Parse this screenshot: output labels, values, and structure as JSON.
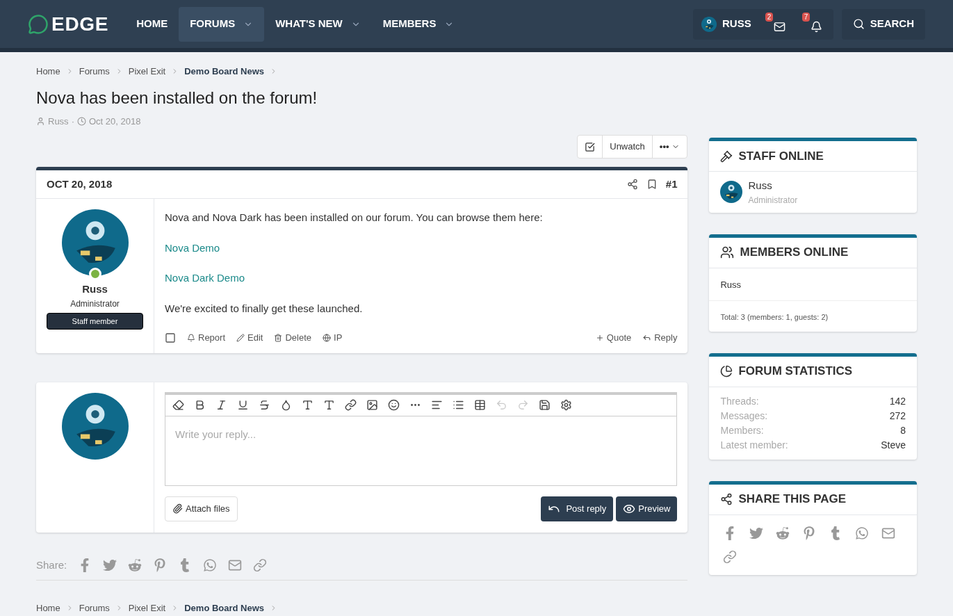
{
  "header": {
    "logo": "EDGE",
    "nav": [
      {
        "label": "HOME",
        "selected": false,
        "dropdown": false
      },
      {
        "label": "FORUMS",
        "selected": true,
        "dropdown": true
      },
      {
        "label": "WHAT'S NEW",
        "selected": false,
        "dropdown": true
      },
      {
        "label": "MEMBERS",
        "selected": false,
        "dropdown": true
      }
    ],
    "user": "RUSS",
    "inbox_count": "2",
    "alerts_count": "7",
    "search": "SEARCH"
  },
  "breadcrumbs": [
    {
      "label": "Home",
      "current": false
    },
    {
      "label": "Forums",
      "current": false
    },
    {
      "label": "Pixel Exit",
      "current": false
    },
    {
      "label": "Demo Board News",
      "current": true
    }
  ],
  "breadcrumbs_bottom": [
    {
      "label": "Home",
      "current": false
    },
    {
      "label": "Forums",
      "current": false
    },
    {
      "label": "Pixel Exit",
      "current": false
    },
    {
      "label": "Demo Board News",
      "current": true
    }
  ],
  "thread": {
    "title": "Nova has been installed on the forum!",
    "author": "Russ",
    "separator": "·",
    "date": "Oct 20, 2018",
    "unwatch": "Unwatch",
    "more": "•••"
  },
  "post": {
    "date": "OCT 20, 2018",
    "number": "#1",
    "user": "Russ",
    "role": "Administrator",
    "badge": "Staff member",
    "online": true,
    "body": [
      {
        "kind": "text",
        "text": "Nova and Nova Dark has been installed on our forum. You can browse them here:"
      },
      {
        "kind": "link",
        "text": "Nova Demo"
      },
      {
        "kind": "link",
        "text": "Nova Dark Demo"
      },
      {
        "kind": "text",
        "text": "We're excited to finally get these launched."
      }
    ],
    "selected": false,
    "actions": [
      "Report",
      "Edit",
      "Delete",
      "IP"
    ],
    "quote": "Quote",
    "reply": "Reply"
  },
  "reply_box": {
    "placeholder": "Write your reply...",
    "attach": "Attach files",
    "post": "Post reply",
    "preview": "Preview"
  },
  "share": {
    "label": "Share:"
  },
  "sidebar": {
    "staff": {
      "title": "STAFF ONLINE",
      "name": "Russ",
      "role": "Administrator"
    },
    "members": {
      "title": "MEMBERS ONLINE",
      "list": "Russ",
      "total": "Total: 3 (members: 1, guests: 2)"
    },
    "stats": {
      "title": "FORUM STATISTICS",
      "rows": [
        {
          "label": "Threads:",
          "value": "142"
        },
        {
          "label": "Messages:",
          "value": "272"
        },
        {
          "label": "Members:",
          "value": "8"
        },
        {
          "label": "Latest member:",
          "value": "Steve"
        }
      ]
    },
    "share": {
      "title": "SHARE THIS PAGE"
    }
  }
}
